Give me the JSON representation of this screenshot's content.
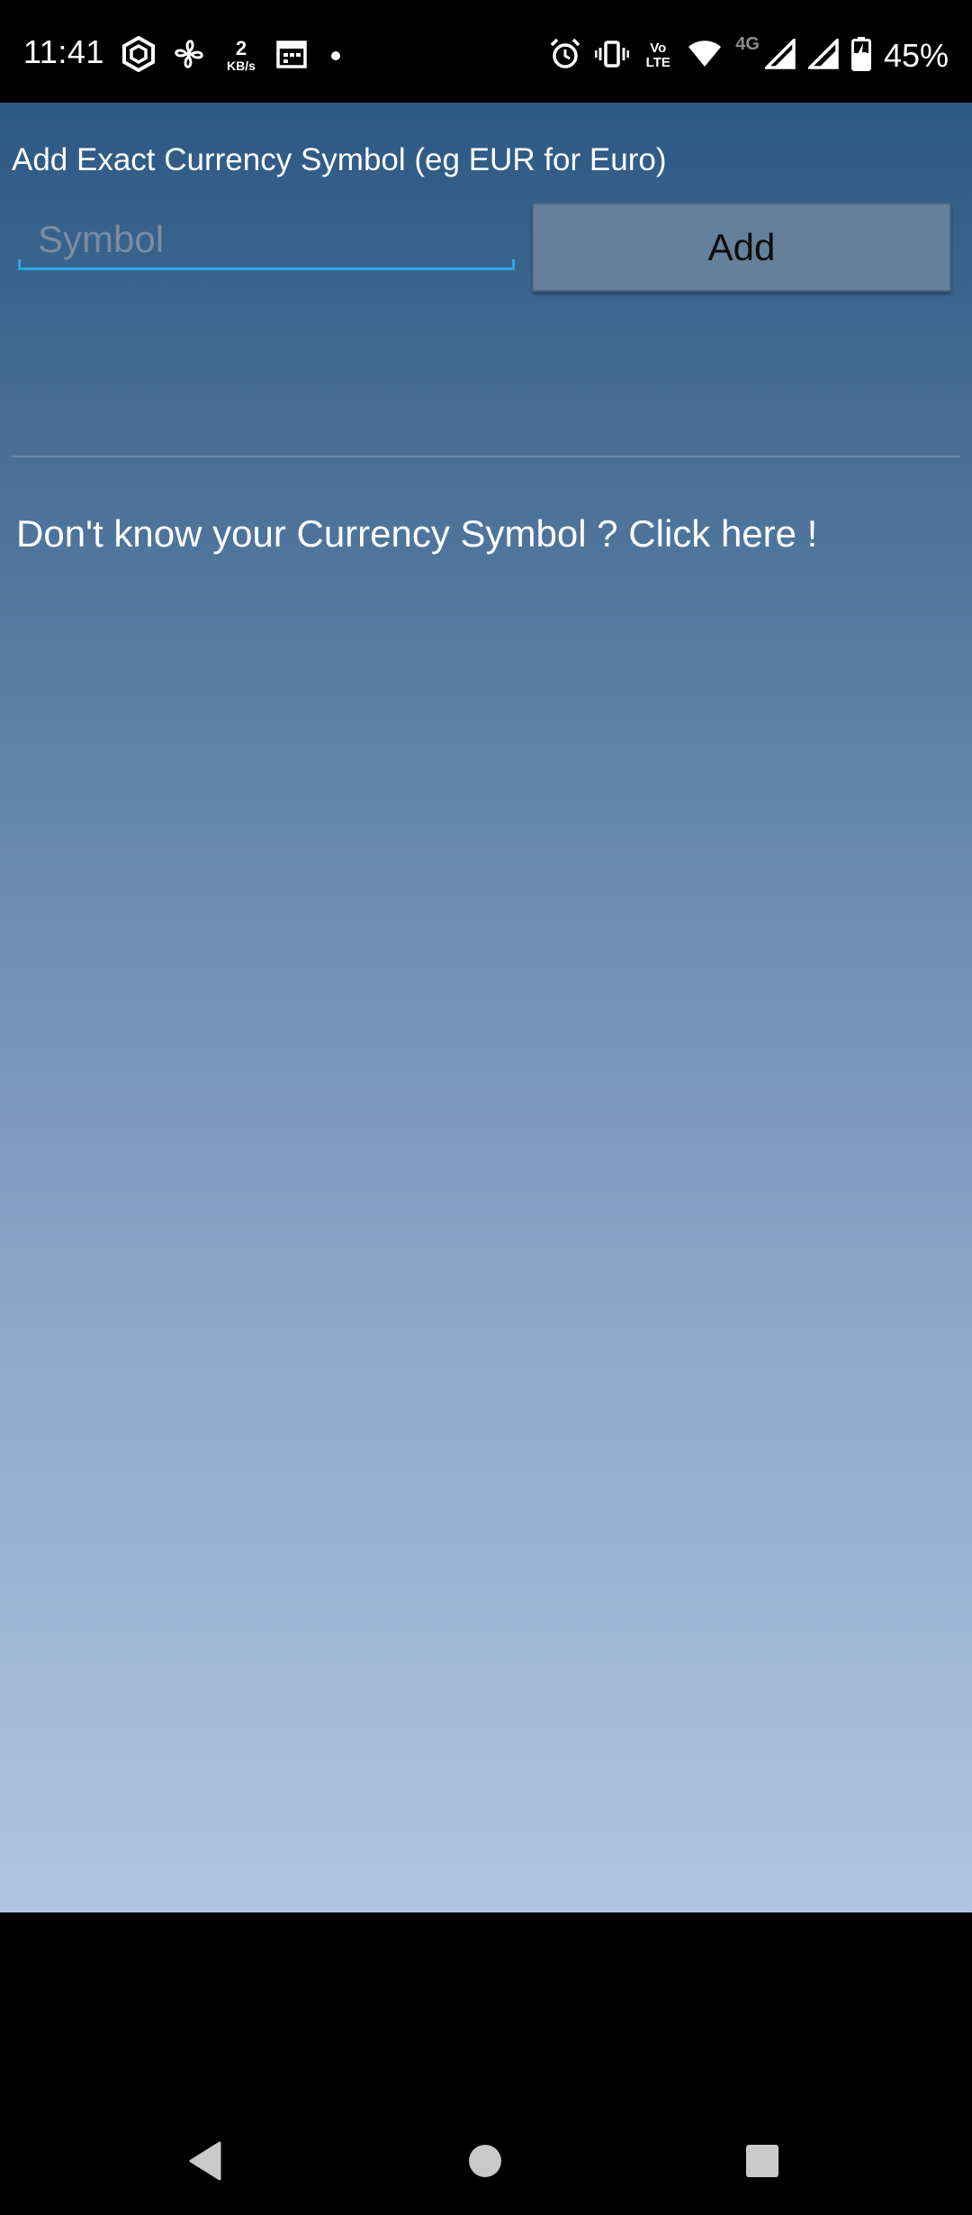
{
  "status_bar": {
    "time": "11:41",
    "net_speed_value": "2",
    "net_speed_unit": "KB/s",
    "volte_top": "Vo",
    "volte_bottom": "LTE",
    "network_type": "4G",
    "battery_percent": "45%",
    "left_icons": [
      "hexagon-app-icon",
      "fan-icon",
      "net-speed-icon",
      "calendar-icon",
      "notification-dot-icon"
    ],
    "right_icons": [
      "alarm-icon",
      "vibrate-icon",
      "volte-icon",
      "wifi-icon",
      "signal-icon",
      "signal-icon",
      "battery-charging-icon"
    ]
  },
  "app": {
    "instruction": "Add Exact Currency Symbol (eg EUR for Euro)",
    "symbol_input": {
      "value": "",
      "placeholder": "Symbol"
    },
    "add_button_label": "Add",
    "help_link": "Don't know your Currency Symbol ? Click here !"
  },
  "nav_bar": {
    "buttons": [
      "back-icon",
      "home-icon",
      "recents-icon"
    ]
  },
  "colors": {
    "gradient_top": "#2c5984",
    "gradient_bottom": "#b0c5e2",
    "input_underline": "#29a8e0",
    "button_bg": "#65809a"
  }
}
